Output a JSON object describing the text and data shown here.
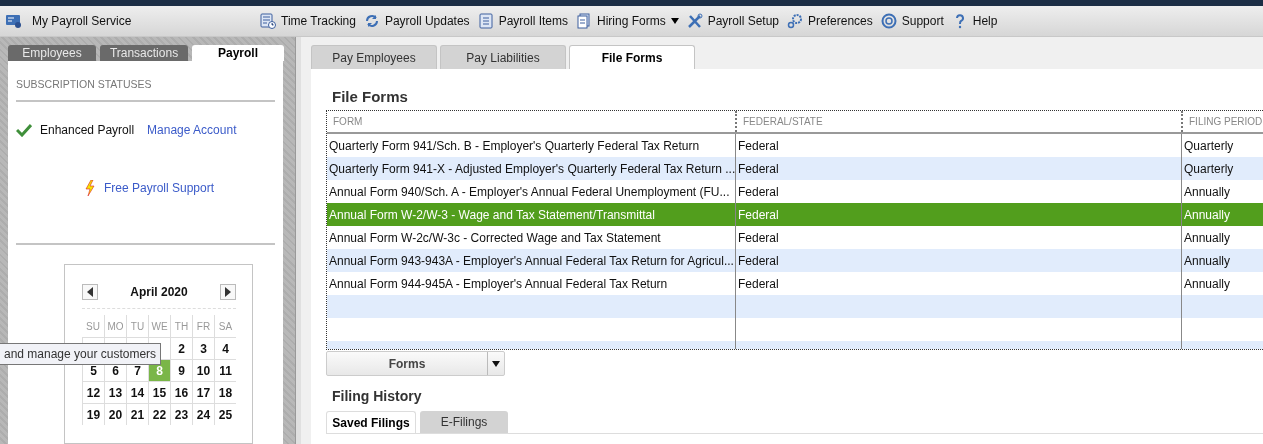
{
  "toolbar": {
    "title": "My Payroll Service",
    "items": [
      {
        "label": "Time Tracking",
        "dropdown": false
      },
      {
        "label": "Payroll Updates",
        "dropdown": false
      },
      {
        "label": "Payroll Items",
        "dropdown": false
      },
      {
        "label": "Hiring Forms",
        "dropdown": true
      },
      {
        "label": "Payroll Setup",
        "dropdown": false
      },
      {
        "label": "Preferences",
        "dropdown": false
      },
      {
        "label": "Support",
        "dropdown": false
      },
      {
        "label": "Help",
        "dropdown": false
      }
    ]
  },
  "sidebar": {
    "tabs": [
      {
        "label": "Employees",
        "selected": false
      },
      {
        "label": "Transactions",
        "selected": false
      },
      {
        "label": "Payroll",
        "selected": true
      }
    ],
    "section_title": "SUBSCRIPTION STATUSES",
    "subscription": {
      "name": "Enhanced Payroll",
      "active": true,
      "link": "Manage Account"
    },
    "support_link": "Free Payroll Support",
    "calendar": {
      "month": "April 2020",
      "weekdays": [
        "SU",
        "MO",
        "TU",
        "WE",
        "TH",
        "FR",
        "SA"
      ],
      "weeks": [
        [
          {
            "day": "2",
            "selected": false
          },
          {
            "day": "3",
            "selected": false
          },
          {
            "day": "4",
            "selected": false
          }
        ],
        [
          {
            "day": "5",
            "selected": false
          },
          {
            "day": "6",
            "selected": false
          },
          {
            "day": "7",
            "selected": false
          },
          {
            "day": "8",
            "selected": true
          },
          {
            "day": "9",
            "selected": false
          },
          {
            "day": "10",
            "selected": false
          },
          {
            "day": "11",
            "selected": false
          }
        ],
        [
          {
            "day": "12",
            "selected": false
          },
          {
            "day": "13",
            "selected": false
          },
          {
            "day": "14",
            "selected": false
          },
          {
            "day": "15",
            "selected": false
          },
          {
            "day": "16",
            "selected": false
          },
          {
            "day": "17",
            "selected": false
          },
          {
            "day": "18",
            "selected": false
          }
        ],
        [
          {
            "day": "19",
            "selected": false
          },
          {
            "day": "20",
            "selected": false
          },
          {
            "day": "21",
            "selected": false
          },
          {
            "day": "22",
            "selected": false
          },
          {
            "day": "23",
            "selected": false
          },
          {
            "day": "24",
            "selected": false
          },
          {
            "day": "25",
            "selected": false
          }
        ]
      ]
    },
    "tooltip": "and manage your customers"
  },
  "main": {
    "tabs": [
      {
        "label": "Pay Employees",
        "selected": false
      },
      {
        "label": "Pay Liabilities",
        "selected": false
      },
      {
        "label": "File Forms",
        "selected": true
      }
    ],
    "title": "File Forms",
    "table": {
      "columns": [
        "FORM",
        "FEDERAL/STATE",
        "FILING PERIOD"
      ],
      "rows": [
        {
          "cells": [
            "Quarterly Form 941/Sch. B - Employer's Quarterly Federal Tax Return",
            "Federal",
            "Quarterly"
          ],
          "selected": false
        },
        {
          "cells": [
            "Quarterly Form 941-X - Adjusted Employer's Quarterly Federal Tax Return ...",
            "Federal",
            "Quarterly"
          ],
          "selected": false
        },
        {
          "cells": [
            "Annual Form 940/Sch. A - Employer's Annual Federal Unemployment (FU...",
            "Federal",
            "Annually"
          ],
          "selected": false
        },
        {
          "cells": [
            "Annual Form W-2/W-3 - Wage and Tax Statement/Transmittal",
            "Federal",
            "Annually"
          ],
          "selected": true
        },
        {
          "cells": [
            "Annual Form W-2c/W-3c - Corrected Wage and Tax Statement",
            "Federal",
            "Annually"
          ],
          "selected": false
        },
        {
          "cells": [
            "Annual Form 943-943A - Employer's Annual Federal Tax Return for Agricul...",
            "Federal",
            "Annually"
          ],
          "selected": false
        },
        {
          "cells": [
            "Annual Form 944-945A - Employer's Annual Federal Tax Return",
            "Federal",
            "Annually"
          ],
          "selected": false
        }
      ]
    },
    "forms_button": "Forms",
    "history_title": "Filing History",
    "history_tabs": [
      {
        "label": "Saved Filings",
        "selected": true
      },
      {
        "label": "E-Filings",
        "selected": false
      }
    ]
  }
}
